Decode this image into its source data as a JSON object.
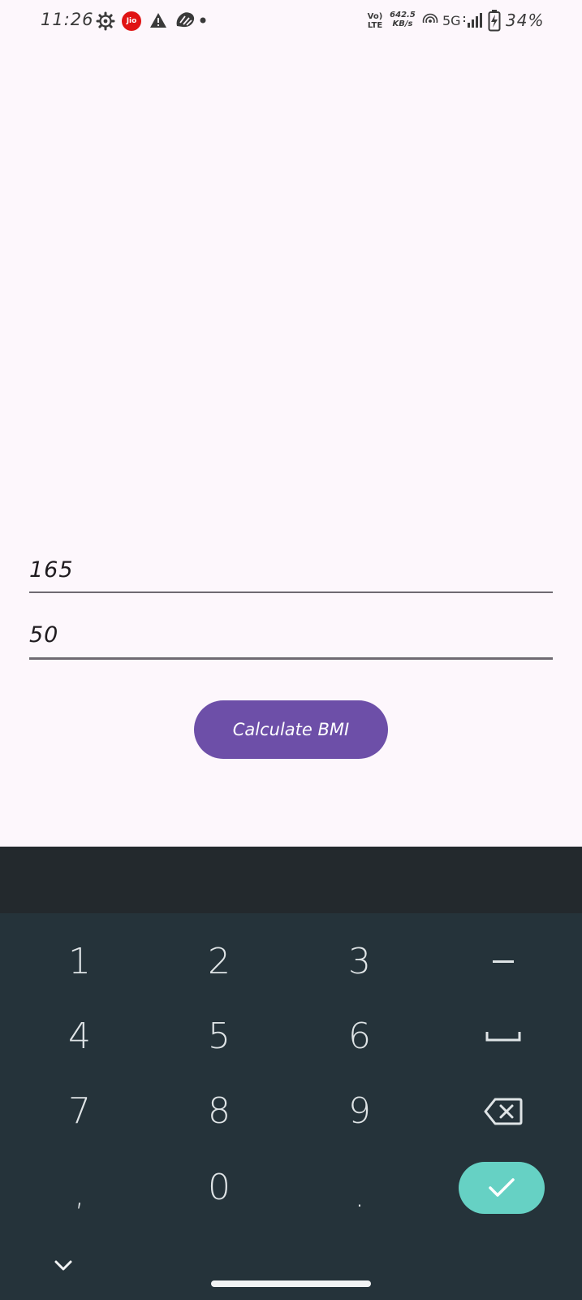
{
  "status_bar": {
    "time": "11:26",
    "carrier_badge": "Jio",
    "volte_top": "Vo)",
    "volte_bottom": "LTE",
    "net_speed_value": "642.5",
    "net_speed_unit": "KB/s",
    "network_type": "5G",
    "battery_percent": "34%",
    "icons": [
      "settings-gear-icon",
      "jio-icon",
      "warning-icon",
      "app-notification-icon",
      "dot-icon",
      "hotspot-icon",
      "signal-icon",
      "battery-charging-icon"
    ]
  },
  "form": {
    "height_value": "165",
    "weight_value": "50",
    "calculate_label": "Calculate BMI"
  },
  "keyboard": {
    "keys": {
      "k1": "1",
      "k2": "2",
      "k3": "3",
      "k4": "4",
      "k5": "5",
      "k6": "6",
      "k7": "7",
      "k8": "8",
      "k9": "9",
      "comma": ",",
      "k0": "0",
      "dot": "."
    },
    "special_icons": [
      "minus-icon",
      "space-icon",
      "backspace-icon",
      "check-icon",
      "chevron-down-icon"
    ]
  },
  "colors": {
    "background": "#fdf7fc",
    "button": "#6d4fa8",
    "keyboard_bg": "#25333a",
    "enter_key": "#66d1c4"
  }
}
